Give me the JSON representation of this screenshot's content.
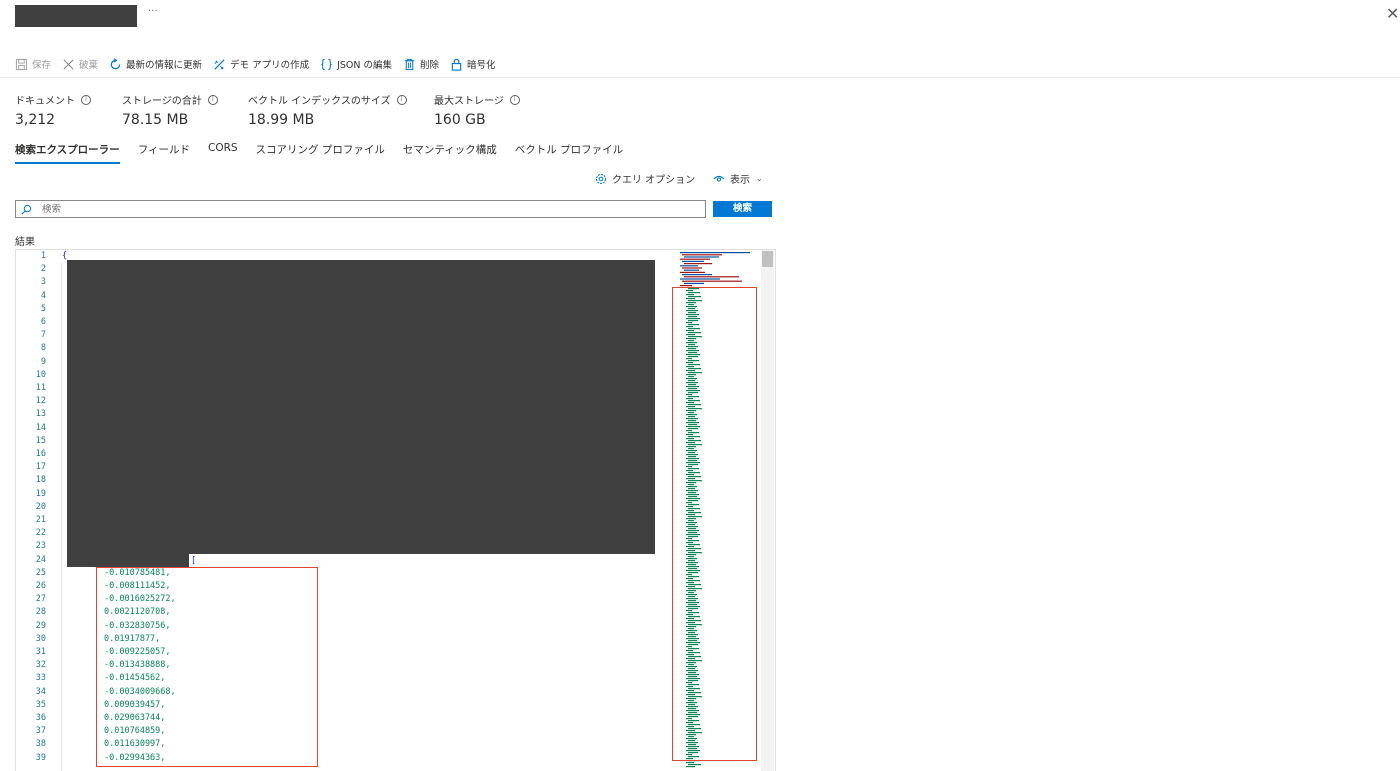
{
  "toolbar": [
    {
      "label": "保存",
      "icon": "save-icon",
      "enabled": false
    },
    {
      "label": "破棄",
      "icon": "discard-icon",
      "enabled": false
    },
    {
      "label": "最新の情報に更新",
      "icon": "refresh-icon",
      "enabled": true
    },
    {
      "label": "デモ アプリの作成",
      "icon": "demo-app-icon",
      "enabled": true
    },
    {
      "label": "JSON の編集",
      "icon": "json-braces-icon",
      "enabled": true
    },
    {
      "label": "削除",
      "icon": "trash-icon",
      "enabled": true
    },
    {
      "label": "暗号化",
      "icon": "lock-icon",
      "enabled": true
    }
  ],
  "header": {
    "more": "···",
    "close": "✕"
  },
  "metrics": [
    {
      "label": "ドキュメント",
      "value": "3,212"
    },
    {
      "label": "ストレージの合計",
      "value": "78.15 MB"
    },
    {
      "label": "ベクトル インデックスのサイズ",
      "value": "18.99 MB"
    },
    {
      "label": "最大ストレージ",
      "value": "160 GB"
    }
  ],
  "tabs": [
    {
      "label": "検索エクスプローラー",
      "active": true
    },
    {
      "label": "フィールド",
      "active": false
    },
    {
      "label": "CORS",
      "active": false
    },
    {
      "label": "スコアリング プロファイル",
      "active": false
    },
    {
      "label": "セマンティック構成",
      "active": false
    },
    {
      "label": "ベクトル プロファイル",
      "active": false
    }
  ],
  "query_options": {
    "label": "クエリ オプション",
    "icon": "gear-icon"
  },
  "view": {
    "label": "表示",
    "icon": "eye-icon"
  },
  "search": {
    "placeholder": "検索",
    "button": "検索"
  },
  "results": {
    "label": "結果",
    "line_numbers": [
      "1",
      "2",
      "3",
      "4",
      "5",
      "6",
      "7",
      "8",
      "9",
      "10",
      "11",
      "12",
      "13",
      "14",
      "15",
      "16",
      "17",
      "18",
      "19",
      "20",
      "21",
      "22",
      "23",
      "24",
      "25",
      "26",
      "27",
      "28",
      "29",
      "30",
      "31",
      "32",
      "33",
      "34",
      "35",
      "36",
      "37",
      "38",
      "39"
    ],
    "first_line": "{",
    "array_open": "[",
    "values": [
      "-0.010785481,",
      "-0.008111452,",
      "-0.0016025272,",
      "0.0021120708,",
      "-0.032830756,",
      "0.01917877,",
      "-0.009225057,",
      "-0.013438888,",
      "-0.01454562,",
      "-0.0034009668,",
      "0.009039457,",
      "0.029063744,",
      "0.010764859,",
      "0.011630997,",
      "-0.02994363,"
    ]
  },
  "colors": {
    "accent": "#0078d4",
    "highlight": "#e0442e",
    "redaction": "#404040",
    "number": "#098658",
    "line_number": "#237893"
  }
}
